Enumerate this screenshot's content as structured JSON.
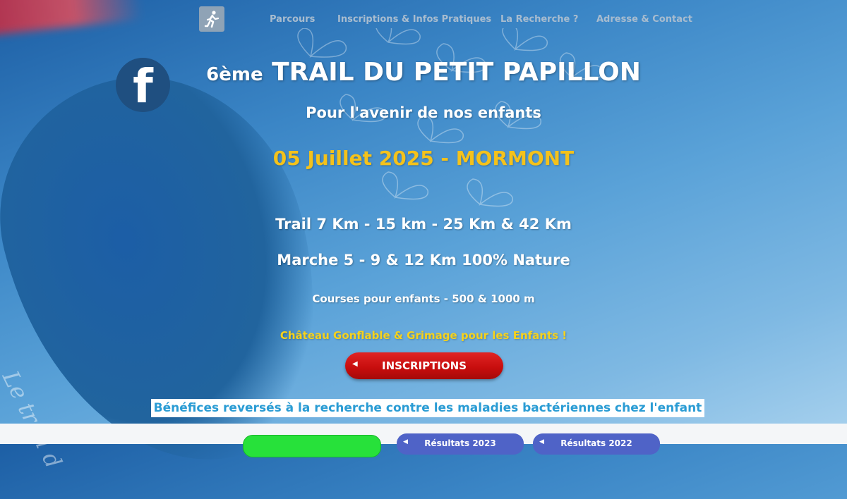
{
  "nav": {
    "logo_icon": "runner-icon",
    "items": [
      {
        "label": "Parcours"
      },
      {
        "label": "Inscriptions & Infos Pratiques"
      },
      {
        "label": "La Recherche ?"
      },
      {
        "label": "Adresse & Contact"
      }
    ]
  },
  "social": {
    "facebook_icon": "facebook-icon",
    "facebook_glyph": "f"
  },
  "hero": {
    "edition": "6ème",
    "title": "TRAIL DU PETIT PAPILLON",
    "subtitle": "Pour l'avenir de nos enfants",
    "date_location": "05 Juillet 2025 - MORMONT",
    "trail": "Trail 7 Km - 15 km - 25 Km & 42 Km",
    "marche": "Marche 5 - 9 & 12 Km 100% Nature",
    "kids": "Courses pour enfants - 500 & 1000 m",
    "animations": "Château Gonflable & Grimage pour les Enfants !"
  },
  "cta": {
    "inscriptions_label": "INSCRIPTIONS"
  },
  "banner": {
    "text": "Bénéfices reversés à la recherche contre les maladies bactériennes chez l'enfant"
  },
  "bottom": {
    "results_2023": "Résultats 2023",
    "results_2022": "Résultats 2022"
  },
  "background": {
    "watermark_text": "Le trail d"
  },
  "colors": {
    "date_yellow": "#f4c21b",
    "cta_red": "#c60d0d",
    "banner_text": "#2a9cd4",
    "results_blue": "#4f63c7",
    "green_button": "#27e13a"
  }
}
